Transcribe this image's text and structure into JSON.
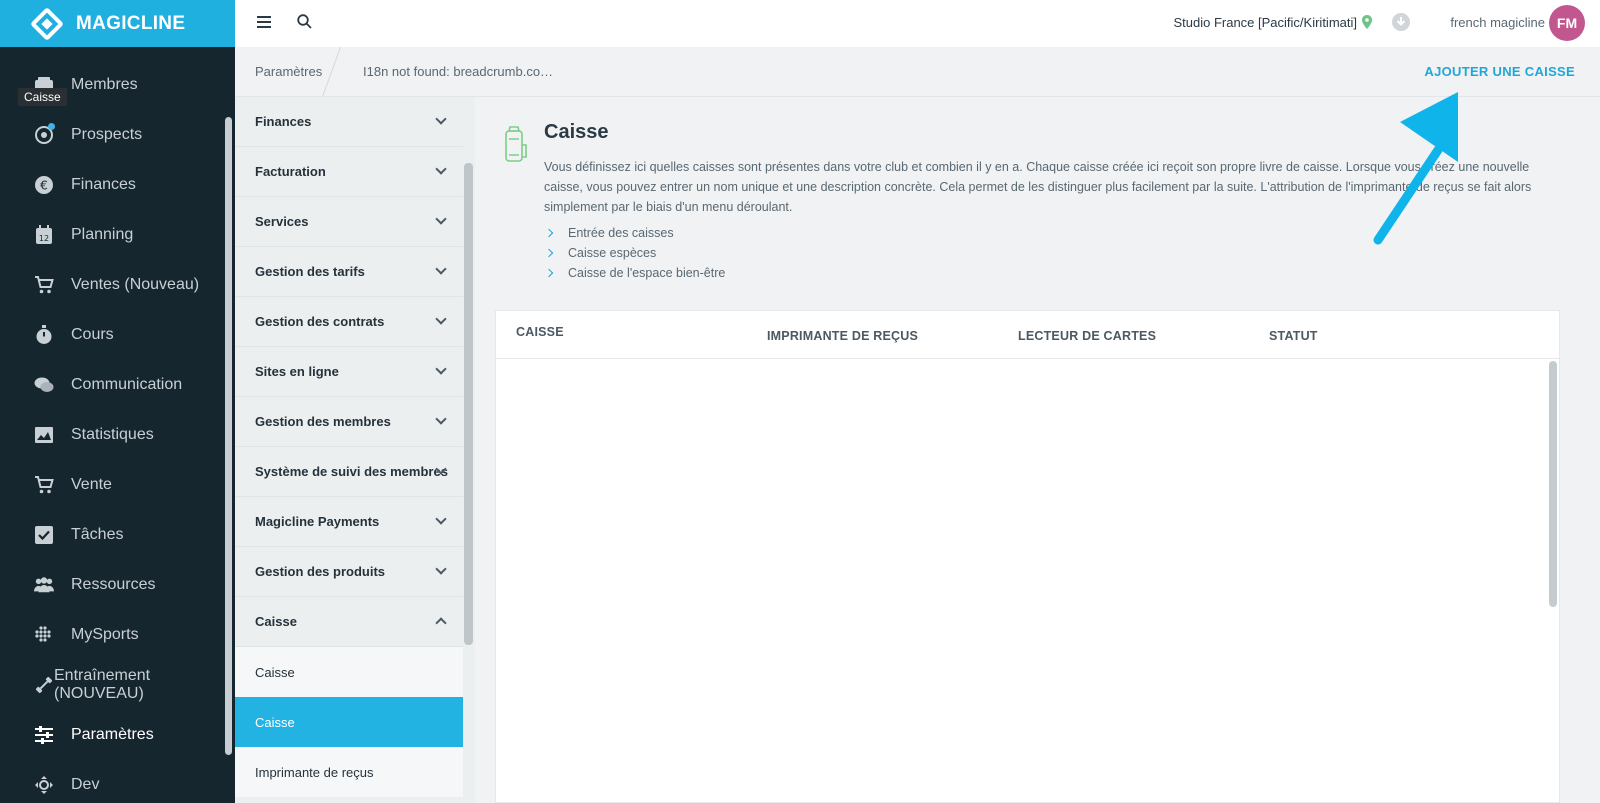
{
  "app": {
    "brand": "MAGICLINE"
  },
  "sidebar": {
    "tooltip": "Caisse",
    "items": [
      {
        "label": "Membres",
        "icon": "members-icon"
      },
      {
        "label": "Prospects",
        "icon": "prospects-icon"
      },
      {
        "label": "Finances",
        "icon": "euro-icon"
      },
      {
        "label": "Planning",
        "icon": "calendar-icon"
      },
      {
        "label": "Ventes (Nouveau)",
        "icon": "cart-icon"
      },
      {
        "label": "Cours",
        "icon": "stopwatch-icon"
      },
      {
        "label": "Communication",
        "icon": "chat-icon"
      },
      {
        "label": "Statistiques",
        "icon": "chart-icon"
      },
      {
        "label": "Vente",
        "icon": "cart-icon"
      },
      {
        "label": "Tâches",
        "icon": "checkbox-icon"
      },
      {
        "label": "Ressources",
        "icon": "people-icon"
      },
      {
        "label": "MySports",
        "icon": "dots-icon"
      },
      {
        "label": "Entraînement (NOUVEAU)",
        "icon": "dumbbell-icon"
      },
      {
        "label": "Paramètres",
        "icon": "sliders-icon",
        "active": true
      },
      {
        "label": "Dev",
        "icon": "move-icon"
      }
    ]
  },
  "header": {
    "studio": "Studio France [Pacific/Kiritimati]",
    "user_name": "french magicline",
    "avatar_initials": "FM"
  },
  "breadcrumb": {
    "root": "Paramètres",
    "current": "I18n not found: breadcrumb.co…",
    "action": "AJOUTER UNE CAISSE"
  },
  "settings_menu": {
    "groups": [
      "Finances",
      "Facturation",
      "Services",
      "Gestion des tarifs",
      "Gestion des contrats",
      "Sites en ligne",
      "Gestion des membres",
      "Système de suivi des membres",
      "Magicline Payments",
      "Gestion des produits",
      "Caisse"
    ],
    "children": [
      "Caisse",
      "Caisse",
      "Imprimante de reçus"
    ]
  },
  "main": {
    "title": "Caisse",
    "description": "Vous définissez ici quelles caisses sont présentes dans votre club et combien il y en a. Chaque caisse créée ici reçoit son propre livre de caisse. Lorsque vous créez une nouvelle caisse, vous pouvez entrer un nom unique et une description concrète. Cela permet de les distinguer plus facilement par la suite. L'attribution de l'imprimante de reçus se fait alors simplement par le biais d'un menu déroulant.",
    "bullets": [
      "Entrée des caisses",
      "Caisse espèces",
      "Caisse de l'espace bien-être"
    ],
    "table": {
      "columns": [
        "CAISSE",
        "IMPRIMANTE DE REÇUS",
        "LECTEUR DE CARTES",
        "STATUT"
      ],
      "rows": []
    }
  },
  "colors": {
    "brand": "#1fb0e0",
    "sidebar_bg": "#15262f",
    "accent": "#1fa7da",
    "avatar": "#c2578f",
    "arrow": "#0fb4ea"
  }
}
